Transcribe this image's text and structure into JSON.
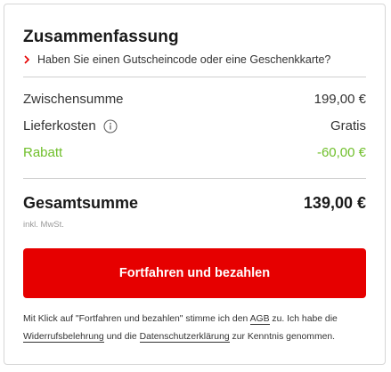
{
  "summary": {
    "title": "Zusammenfassung",
    "voucher_link": "Haben Sie einen Gutscheincode oder eine Geschenkkarte?",
    "subtotal_label": "Zwischensumme",
    "subtotal_value": "199,00 €",
    "shipping_label": "Lieferkosten",
    "shipping_value": "Gratis",
    "discount_label": "Rabatt",
    "discount_value": "-60,00 €",
    "total_label": "Gesamtsumme",
    "total_value": "139,00 €",
    "vat_note": "inkl. MwSt.",
    "pay_button": "Fortfahren und bezahlen",
    "legal": {
      "part1": "Mit Klick auf \"Fortfahren und bezahlen\" stimme ich den ",
      "agb_link": "AGB",
      "part2": " zu. Ich habe die ",
      "withdrawal_link": "Widerrufsbelehrung",
      "part3": " und die ",
      "privacy_link": "Datenschutzerklärung",
      "part4": " zur Kenntnis genommen."
    }
  },
  "colors": {
    "accent": "#e60000",
    "discount": "#6fbf2a",
    "divider": "#cfcfcf"
  },
  "icons": {
    "voucher": "chevron-right-icon",
    "shipping_info": "info-icon"
  }
}
